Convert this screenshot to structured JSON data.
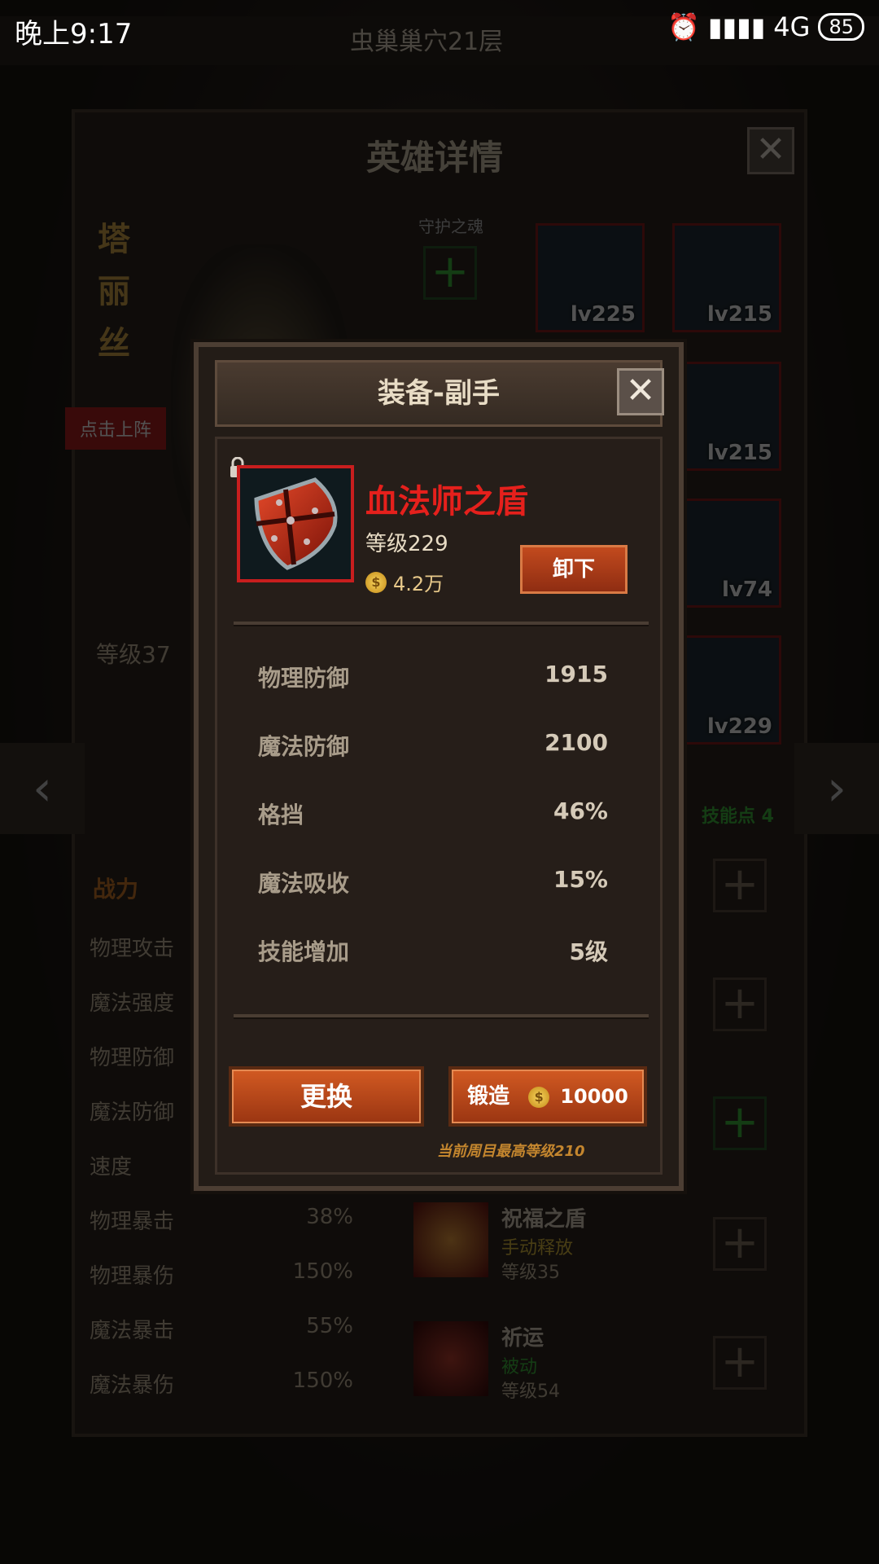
{
  "status_bar": {
    "time": "晚上9:17",
    "network": "4G",
    "battery": "85"
  },
  "background": {
    "top_bar_text": "虫巢巢穴21层",
    "window_title": "英雄详情",
    "hero_name_chars": [
      "塔",
      "丽",
      "丝"
    ],
    "guardian_soul_label": "守护之魂",
    "deploy_tag": "点击上阵",
    "hero_level": "等级37",
    "equipment_levels": [
      "lv225",
      "lv215",
      "lv215",
      "lv74",
      "lv229"
    ],
    "skill_points": "技能点 4",
    "stats_header": "战力",
    "stats": [
      {
        "label": "物理攻击",
        "value": ""
      },
      {
        "label": "魔法强度",
        "value": ""
      },
      {
        "label": "物理防御",
        "value": ""
      },
      {
        "label": "魔法防御",
        "value": ""
      },
      {
        "label": "速度",
        "value": ""
      },
      {
        "label": "物理暴击",
        "value": "38%"
      },
      {
        "label": "物理暴伤",
        "value": "150%"
      },
      {
        "label": "魔法暴击",
        "value": "55%"
      },
      {
        "label": "魔法暴伤",
        "value": "150%"
      }
    ],
    "skills": [
      {
        "name": "祝福之盾",
        "type": "手动释放",
        "level": "等级35"
      },
      {
        "name": "祈运",
        "type": "被动",
        "level": "等级54"
      }
    ]
  },
  "modal": {
    "title": "装备-副手",
    "item": {
      "name": "血法师之盾",
      "level": "等级229",
      "price": "4.2万"
    },
    "unequip_label": "卸下",
    "stats": [
      {
        "label": "物理防御",
        "value": "1915"
      },
      {
        "label": "魔法防御",
        "value": "2100"
      },
      {
        "label": "格挡",
        "value": "46%"
      },
      {
        "label": "魔法吸收",
        "value": "15%"
      },
      {
        "label": "技能增加",
        "value": "5级"
      }
    ],
    "replace_label": "更换",
    "forge_label": "锻造",
    "forge_cost": "10000",
    "note": "当前周目最高等级210"
  }
}
